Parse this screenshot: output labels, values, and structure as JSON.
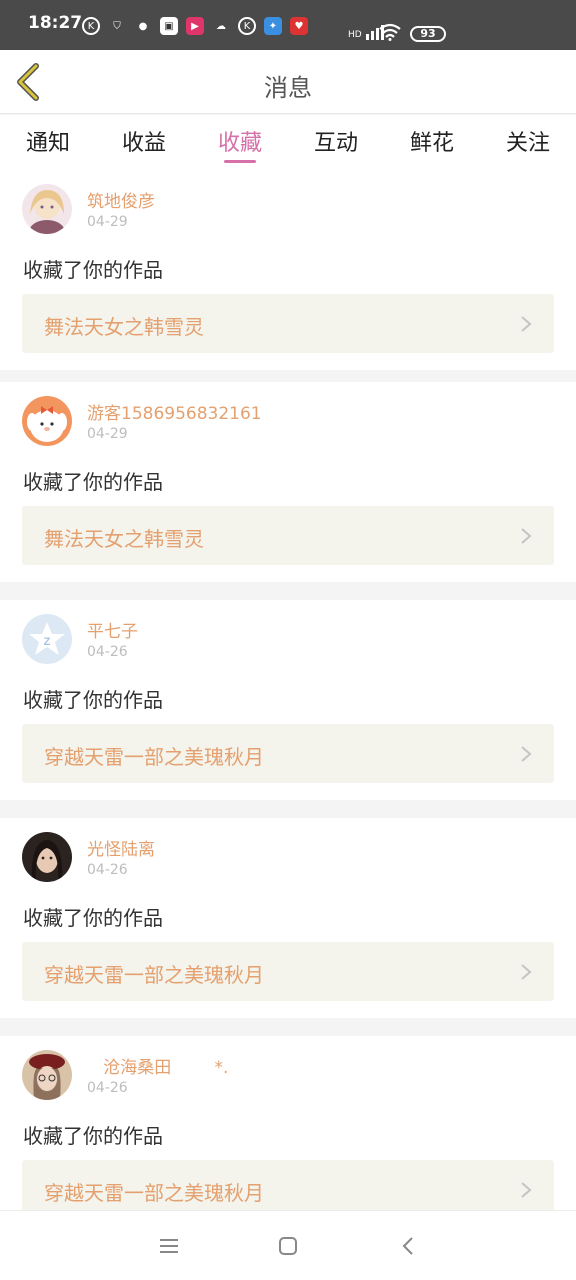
{
  "status_bar": {
    "time": "18:27",
    "battery": "93"
  },
  "header": {
    "title": "消息"
  },
  "tabs": [
    {
      "label": "通知"
    },
    {
      "label": "收益"
    },
    {
      "label": "收藏"
    },
    {
      "label": "互动"
    },
    {
      "label": "鲜花"
    },
    {
      "label": "关注"
    }
  ],
  "feed": [
    {
      "user": "筑地俊彦",
      "date": "04-29",
      "action": "收藏了你的作品",
      "work": "舞法天女之韩雪灵"
    },
    {
      "user": "游客1586956832161",
      "date": "04-29",
      "action": "收藏了你的作品",
      "work": "舞法天女之韩雪灵"
    },
    {
      "user": "平七子",
      "date": "04-26",
      "action": "收藏了你的作品",
      "work": "穿越天雷一部之美瑰秋月"
    },
    {
      "user": "光怪陆离",
      "date": "04-26",
      "action": "收藏了你的作品",
      "work": "穿越天雷一部之美瑰秋月"
    },
    {
      "user": "   沧海桑田        *.",
      "date": "04-26",
      "action": "收藏了你的作品",
      "work": "穿越天雷一部之美瑰秋月"
    }
  ],
  "colors": {
    "accent": "#d670a8",
    "username": "#e4a06e",
    "work_bg": "#f4f3ec"
  }
}
